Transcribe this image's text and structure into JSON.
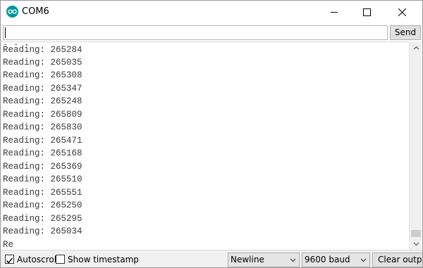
{
  "window": {
    "title": "COM6",
    "app_icon": "arduino-infinity-icon"
  },
  "input_row": {
    "value": "",
    "send_label": "Send"
  },
  "output": {
    "clipped_top": "ˍ ˍ ˍ",
    "lines": [
      "Reading: 265284",
      "Reading: 265035",
      "Reading: 265308",
      "Reading: 265347",
      "Reading: 265248",
      "Reading: 265809",
      "Reading: 265830",
      "Reading: 265471",
      "Reading: 265168",
      "Reading: 265369",
      "Reading: 265510",
      "Reading: 265551",
      "Reading: 265250",
      "Reading: 265295",
      "Reading: 265034",
      "Re"
    ]
  },
  "bottom_bar": {
    "autoscroll_label": "Autoscroll",
    "autoscroll_checked": true,
    "timestamp_label": "Show timestamp",
    "timestamp_checked": false,
    "line_ending": "Newline",
    "baud": "9600 baud",
    "clear_label": "Clear output"
  },
  "colors": {
    "accent": "#00979c",
    "text": "#3a3a3a"
  }
}
